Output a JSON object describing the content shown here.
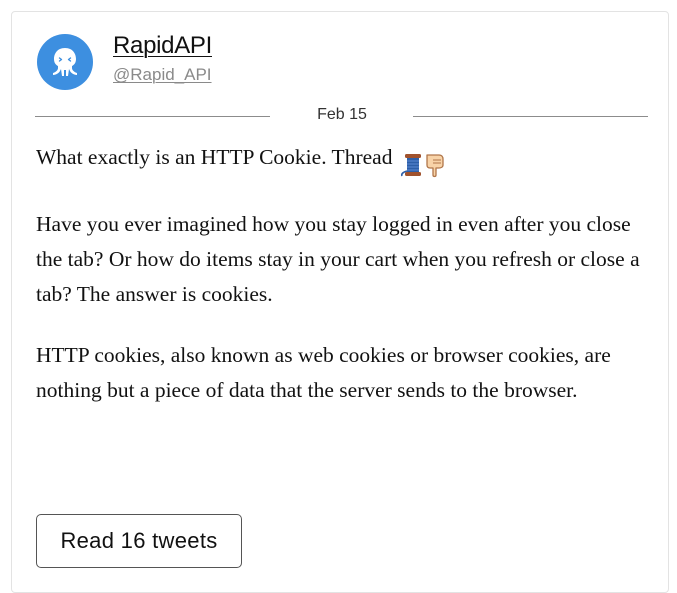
{
  "author": {
    "display_name": "RapidAPI",
    "handle": "@Rapid_API",
    "avatar_icon": "octopus-logo-icon",
    "avatar_color": "#3d8fe0"
  },
  "date": "Feb 15",
  "tweet": {
    "paragraph_1": "What exactly is an HTTP Cookie. Thread",
    "paragraph_1_emojis": [
      "thread-spool-emoji",
      "pointing-down-emoji"
    ],
    "paragraph_2": "Have you ever imagined how you stay logged in even after you close the tab? Or how do items stay in your cart when you refresh or close a tab? The answer is cookies.",
    "paragraph_3": "HTTP cookies, also known as web cookies or browser cookies, are nothing but a piece of data that the server sends to the browser."
  },
  "read_button": {
    "label": "Read 16 tweets"
  }
}
